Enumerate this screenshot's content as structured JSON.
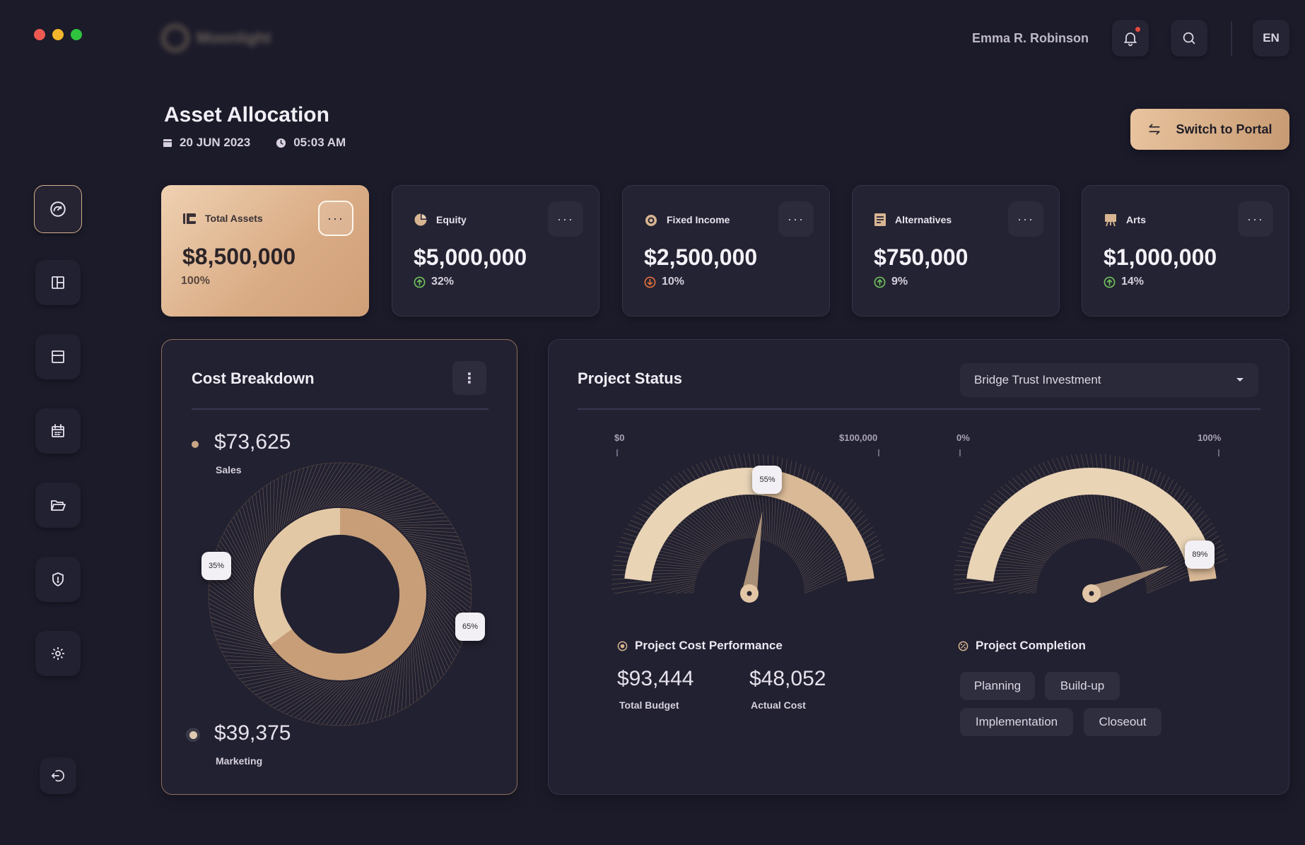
{
  "brand": {
    "name": "Moonlight"
  },
  "user": {
    "name": "Emma R. Robinson",
    "language": "EN"
  },
  "header": {
    "title": "Asset Allocation",
    "date": "20 JUN 2023",
    "time": "05:03 AM",
    "switch_label": "Switch to Portal"
  },
  "sidebar": {
    "items": [
      {
        "icon": "gauge-icon",
        "active": true
      },
      {
        "icon": "layout-icon"
      },
      {
        "icon": "window-icon"
      },
      {
        "icon": "calendar-icon"
      },
      {
        "icon": "folder-icon"
      },
      {
        "icon": "shield-icon"
      },
      {
        "icon": "gear-icon"
      },
      {
        "icon": "logout-icon"
      }
    ]
  },
  "cards": [
    {
      "label": "Total Assets",
      "amount": "$8,500,000",
      "pct": "100%",
      "icon": "wallet-icon",
      "active": true
    },
    {
      "label": "Equity",
      "amount": "$5,000,000",
      "pct": "32%",
      "trend": "up",
      "icon": "pie-icon"
    },
    {
      "label": "Fixed Income",
      "amount": "$2,500,000",
      "pct": "10%",
      "trend": "down",
      "icon": "coins-icon"
    },
    {
      "label": "Alternatives",
      "amount": "$750,000",
      "pct": "9%",
      "trend": "up",
      "icon": "document-icon"
    },
    {
      "label": "Arts",
      "amount": "$1,000,000",
      "pct": "14%",
      "trend": "up",
      "icon": "easel-icon"
    }
  ],
  "cost_breakdown": {
    "title": "Cost Breakdown",
    "sales": {
      "value": "$73,625",
      "label": "Sales"
    },
    "marketing": {
      "value": "$39,375",
      "label": "Marketing"
    },
    "pct_left": "35%",
    "pct_right": "65%"
  },
  "project_status": {
    "title": "Project Status",
    "selected_project": "Bridge Trust Investment",
    "cost_gauge": {
      "min_label": "$0",
      "max_label": "$100,000",
      "value": 0.55,
      "badge": "55%"
    },
    "completion_gauge": {
      "min_label": "0%",
      "max_label": "100%",
      "value": 0.89,
      "badge": "89%"
    },
    "cost_performance": {
      "title": "Project Cost Performance",
      "total_budget": "$93,444",
      "total_budget_label": "Total Budget",
      "actual_cost": "$48,052",
      "actual_cost_label": "Actual Cost"
    },
    "completion": {
      "title": "Project Completion",
      "phases": [
        "Planning",
        "Build-up",
        "Implementation",
        "Closeout"
      ]
    }
  },
  "colors": {
    "background": "#1c1b2a",
    "accent": "#d9ab84",
    "up": "#6fbf5a",
    "down": "#e0703a",
    "notification": "#e5483b"
  }
}
